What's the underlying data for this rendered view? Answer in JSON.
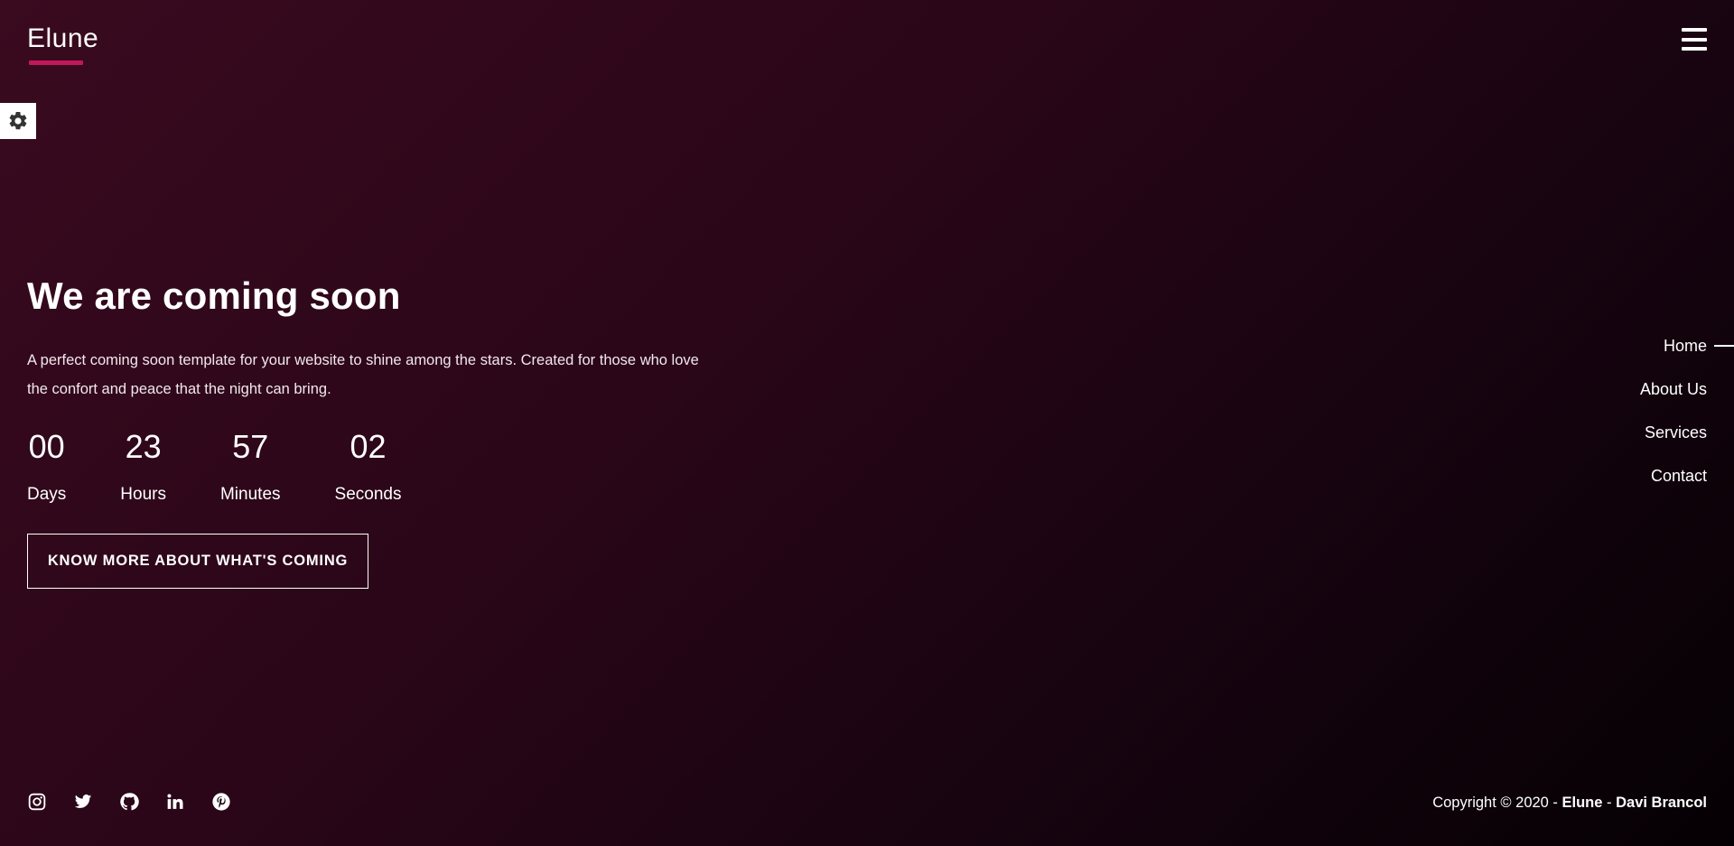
{
  "header": {
    "logo": "Elune",
    "menu_icon": "hamburger-icon",
    "settings_icon": "gear-icon"
  },
  "hero": {
    "title": "We are coming soon",
    "description": "A perfect coming soon template for your website to shine among the stars. Created for those who love the confort and peace that the night can bring.",
    "countdown": [
      {
        "value": "00",
        "label": "Days"
      },
      {
        "value": "23",
        "label": "Hours"
      },
      {
        "value": "57",
        "label": "Minutes"
      },
      {
        "value": "02",
        "label": "Seconds"
      }
    ],
    "cta_label": "Know more about what's coming"
  },
  "side_nav": {
    "items": [
      {
        "label": "Home",
        "active": true
      },
      {
        "label": "About Us",
        "active": false
      },
      {
        "label": "Services",
        "active": false
      },
      {
        "label": "Contact",
        "active": false
      }
    ]
  },
  "footer": {
    "social_icons": [
      "instagram-icon",
      "twitter-icon",
      "github-icon",
      "linkedin-icon",
      "pinterest-icon"
    ],
    "copyright_prefix": "Copyright © 2020 - ",
    "copyright_brand": "Elune",
    "copyright_sep": " - ",
    "copyright_author": "Davi Brancol"
  },
  "colors": {
    "accent": "#c2185b",
    "bg_start": "#3a0a1f",
    "bg_end": "#050003"
  }
}
